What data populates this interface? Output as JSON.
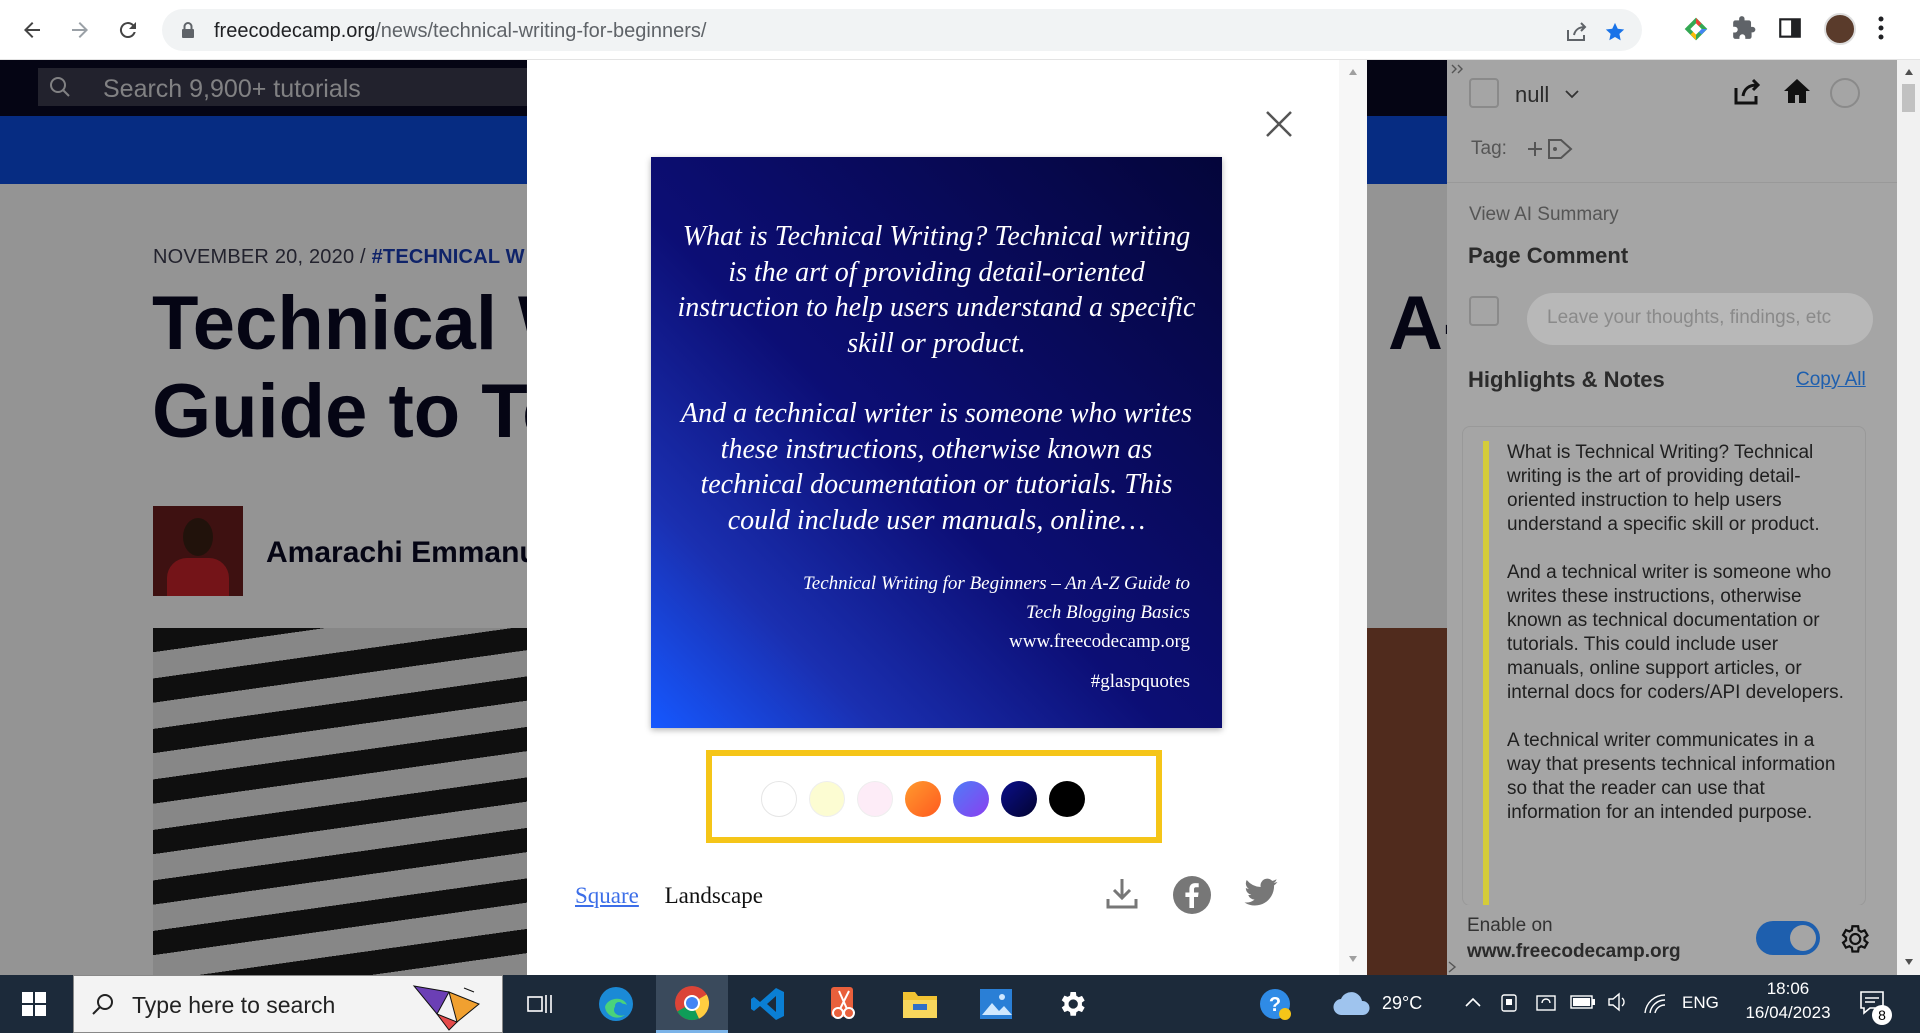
{
  "browser": {
    "url_host": "freecodecamp.org",
    "url_path": "/news/technical-writing-for-beginners/"
  },
  "site": {
    "search_placeholder": "Search 9,900+ tutorials",
    "post_date": "NOVEMBER 20, 2020",
    "post_separator": "/",
    "post_tag": "#TECHNICAL W",
    "title_line1": "Technical W",
    "title_line2": "Guide to Te",
    "title_right": "A-",
    "author": "Amarachi Emmanue"
  },
  "modal": {
    "quote_paragraph1": "What is Technical Writing? Technical writing is the art of providing detail-oriented instruction to help users understand a specific skill or product.",
    "quote_paragraph2": "And a technical writer is someone who writes these instructions, otherwise known as technical documentation or tutorials. This could include user manuals, online…",
    "source_title_line1": "Technical Writing for Beginners – An A-Z Guide to",
    "source_title_line2": "Tech Blogging Basics",
    "source_site": "www.freecodecamp.org",
    "hashtag": "#glaspquotes",
    "square_label": "Square",
    "landscape_label": "Landscape",
    "swatches": [
      "#ffffff",
      "#fcfcd2",
      "#fdecf7",
      "orange-gradient",
      "blue-violet-gradient",
      "#06095e",
      "#000000"
    ]
  },
  "panel": {
    "user_name": "null",
    "tag_label": "Tag:",
    "ai_summary": "View AI Summary",
    "page_comment_heading": "Page Comment",
    "comment_placeholder": "Leave your thoughts, findings, etc",
    "highlights_heading": "Highlights & Notes",
    "copy_all": "Copy All",
    "highlight_p1": "What is Technical Writing? Technical writing is the art of providing detail-oriented instruction to help users understand a specific skill or product.",
    "highlight_p2": "And a technical writer is someone who writes these instructions, otherwise known as technical documentation or tutorials. This could include user manuals, online support articles, or internal docs for coders/API developers.",
    "highlight_p3": "A technical writer communicates in a way that presents technical information so that the reader can use that information for an intended purpose.",
    "enable_on": "Enable on",
    "enable_site": "www.freecodecamp.org",
    "toggle_on": true
  },
  "taskbar": {
    "search_placeholder": "Type here to search",
    "temperature": "29°C",
    "language": "ENG",
    "time": "18:06",
    "date": "16/04/2023",
    "notification_count": "8"
  }
}
